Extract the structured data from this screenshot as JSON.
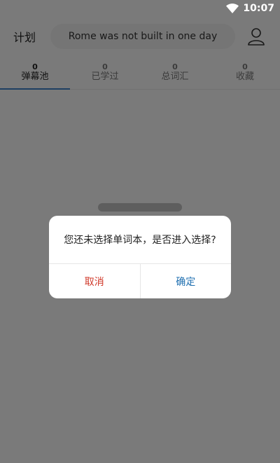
{
  "status_bar": {
    "time": "10:07",
    "wifi_icon": "wifi-icon"
  },
  "header": {
    "plan_label": "计划",
    "slogan": "Rome was not built in one day",
    "user_icon": "user-icon"
  },
  "tabs": [
    {
      "count": "0",
      "label": "弹幕池",
      "active": true
    },
    {
      "count": "0",
      "label": "已学过",
      "active": false
    },
    {
      "count": "0",
      "label": "总词汇",
      "active": false
    },
    {
      "count": "0",
      "label": "收藏",
      "active": false
    }
  ],
  "dialog": {
    "message": "您还未选择单词本，是否进入选择?",
    "cancel_label": "取消",
    "confirm_label": "确定",
    "cancel_color": "#d0392a",
    "confirm_color": "#1f6fb0"
  },
  "background": {
    "hint_text": ""
  }
}
